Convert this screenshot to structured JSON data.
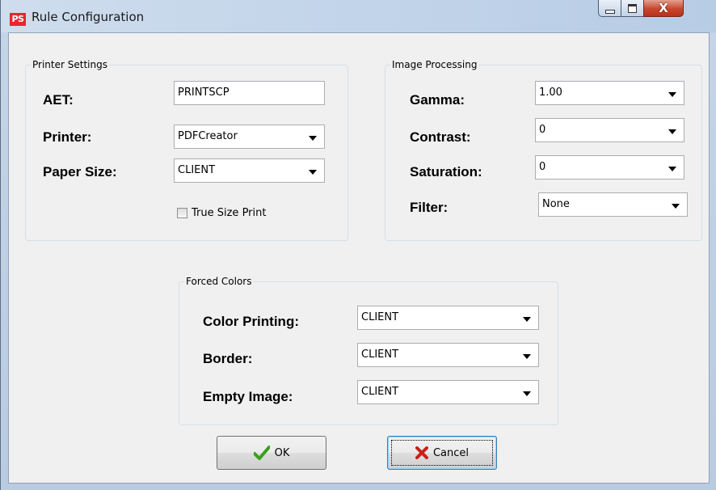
{
  "window": {
    "app_icon": "PS",
    "title": "Rule Configuration",
    "controls": {
      "minimize": "minimize-icon",
      "maximize": "maximize-icon",
      "close": "close-icon"
    },
    "close_glyph": "X"
  },
  "printer_settings": {
    "legend": "Printer Settings",
    "aet_label": "AET:",
    "aet_value": "PRINTSCP",
    "printer_label": "Printer:",
    "printer_value": "PDFCreator",
    "paper_size_label": "Paper Size:",
    "paper_size_value": "CLIENT",
    "true_size_label": "True Size Print",
    "true_size_checked": false
  },
  "image_processing": {
    "legend": "Image Processing",
    "gamma_label": "Gamma:",
    "gamma_value": "1.00",
    "contrast_label": "Contrast:",
    "contrast_value": "0",
    "saturation_label": "Saturation:",
    "saturation_value": "0",
    "filter_label": "Filter:",
    "filter_value": "None"
  },
  "forced_colors": {
    "legend": "Forced Colors",
    "color_printing_label": "Color Printing:",
    "color_printing_value": "CLIENT",
    "border_label": "Border:",
    "border_value": "CLIENT",
    "empty_image_label": "Empty Image:",
    "empty_image_value": "CLIENT"
  },
  "buttons": {
    "ok_label": "OK",
    "ok_icon": "checkmark-icon",
    "cancel_label": "Cancel",
    "cancel_icon": "x-mark-icon"
  },
  "colors": {
    "ok_check": "#3aa020",
    "cancel_x": "#c8201a",
    "app_icon_bg": "#e8262f"
  }
}
